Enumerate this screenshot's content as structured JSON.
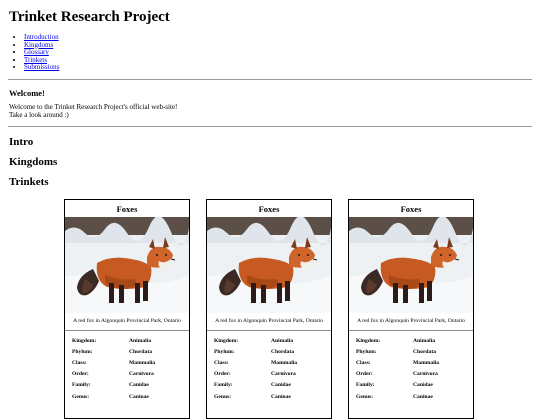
{
  "site_title": "Trinket Research Project",
  "nav": [
    "Introduction",
    "Kingdoms",
    "Glossary",
    "Trinkets",
    "Submissions"
  ],
  "welcome": {
    "title": "Welcome!",
    "line1": "Welcome to the Trinket Research Project's official web-site!",
    "line2": "Take a look around :)"
  },
  "sections": {
    "intro": "Intro",
    "kingdoms": "Kingdoms",
    "trinkets": "Trinkets"
  },
  "cards": [
    {
      "title": "Foxes",
      "caption": "A red fox in Algonquin Provincial Park, Ontario",
      "rows": [
        [
          "Kingdom:",
          "Animalia"
        ],
        [
          "Phylum:",
          "Chordata"
        ],
        [
          "Class:",
          "Mammalia"
        ],
        [
          "Order:",
          "Carnivora"
        ],
        [
          "Family:",
          "Canidae"
        ],
        [
          "Genus:",
          "Caninae"
        ]
      ]
    },
    {
      "title": "Foxes",
      "caption": "A red fox in Algonquin Provincial Park, Ontario",
      "rows": [
        [
          "Kingdom:",
          "Animalia"
        ],
        [
          "Phylum:",
          "Chordata"
        ],
        [
          "Class:",
          "Mammalia"
        ],
        [
          "Order:",
          "Carnivora"
        ],
        [
          "Family:",
          "Canidae"
        ],
        [
          "Genus:",
          "Caninae"
        ]
      ]
    },
    {
      "title": "Foxes",
      "caption": "A red fox in Algonquin Provincial Park, Ontario",
      "rows": [
        [
          "Kingdom:",
          "Animalia"
        ],
        [
          "Phylum:",
          "Chordata"
        ],
        [
          "Class:",
          "Mammalia"
        ],
        [
          "Order:",
          "Carnivora"
        ],
        [
          "Family:",
          "Canidae"
        ],
        [
          "Genus:",
          "Caninae"
        ]
      ]
    }
  ]
}
